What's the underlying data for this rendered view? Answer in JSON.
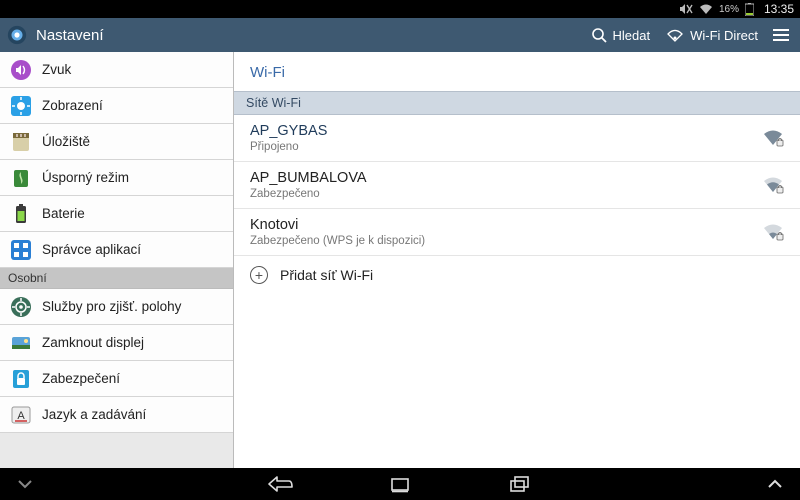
{
  "status_bar": {
    "battery_pct": "16%",
    "clock": "13:35"
  },
  "action_bar": {
    "title": "Nastavení",
    "search_label": "Hledat",
    "wifi_direct_label": "Wi-Fi Direct"
  },
  "sidebar": {
    "items": [
      {
        "id": "sound",
        "label": "Zvuk"
      },
      {
        "id": "display",
        "label": "Zobrazení"
      },
      {
        "id": "storage",
        "label": "Úložiště"
      },
      {
        "id": "power",
        "label": "Úsporný režim"
      },
      {
        "id": "battery",
        "label": "Baterie"
      },
      {
        "id": "apps",
        "label": "Správce aplikací"
      }
    ],
    "section_personal": "Osobní",
    "personal_items": [
      {
        "id": "location",
        "label": "Služby pro zjišť. polohy"
      },
      {
        "id": "lock",
        "label": "Zamknout displej"
      },
      {
        "id": "security",
        "label": "Zabezpečení"
      },
      {
        "id": "lang",
        "label": "Jazyk a zadávání"
      }
    ]
  },
  "main": {
    "title": "Wi-Fi",
    "section_label": "Sítě Wi-Fi",
    "networks": [
      {
        "ssid": "AP_GYBAS",
        "sub": "Připojeno",
        "connected": true,
        "locked": true,
        "strength": 3
      },
      {
        "ssid": "AP_BUMBALOVA",
        "sub": "Zabezpečeno",
        "connected": false,
        "locked": true,
        "strength": 2
      },
      {
        "ssid": "Knotovi",
        "sub": "Zabezpečeno (WPS je k dispozici)",
        "connected": false,
        "locked": true,
        "strength": 1
      }
    ],
    "add_label": "Přidat síť Wi-Fi"
  }
}
